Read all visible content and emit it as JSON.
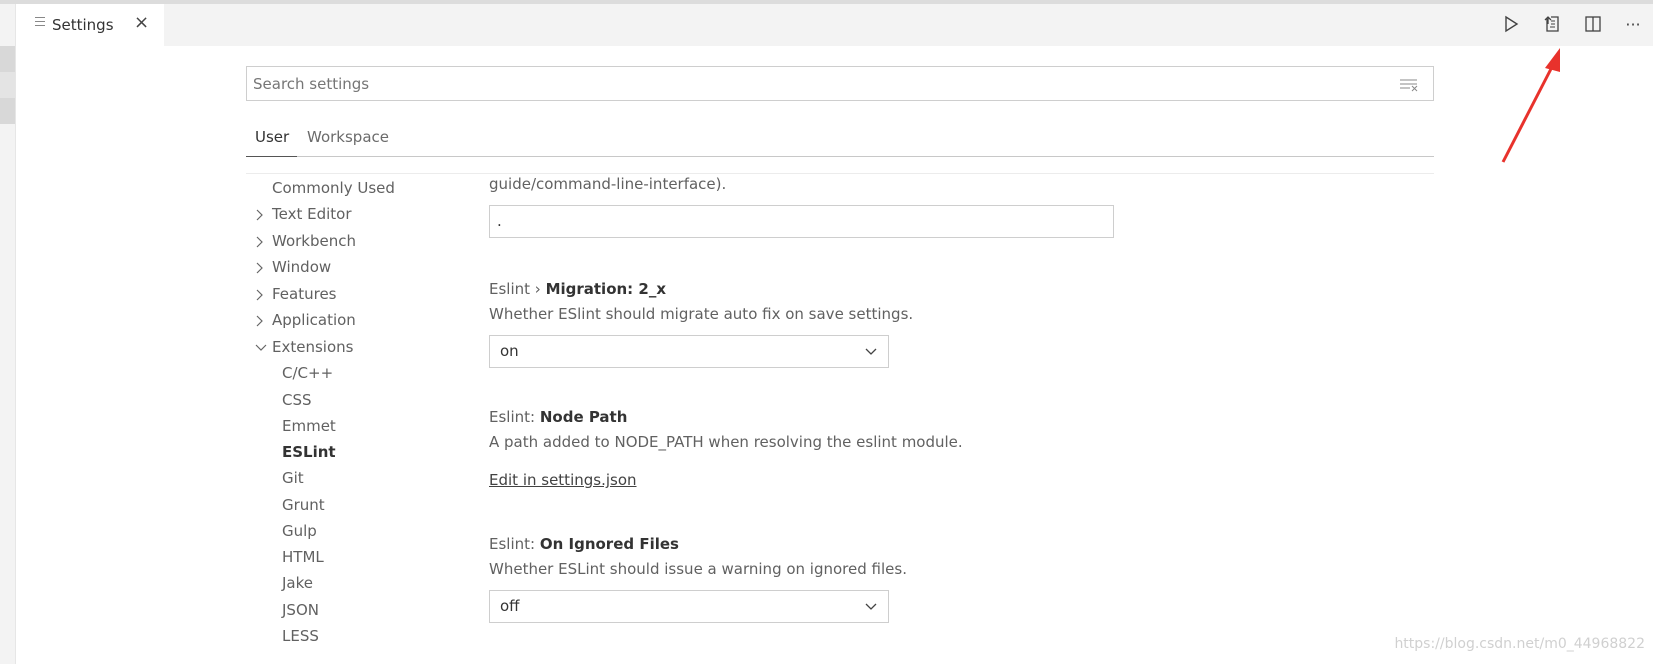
{
  "tab": {
    "title": "Settings",
    "close": "×"
  },
  "toolbar": {
    "actions": [
      {
        "name": "run-icon"
      },
      {
        "name": "open-settings-json-icon"
      },
      {
        "name": "split-editor-icon"
      },
      {
        "name": "more-actions-icon",
        "label": "···"
      }
    ]
  },
  "search": {
    "placeholder": "Search settings",
    "value": ""
  },
  "scope_tabs": {
    "user": "User",
    "workspace": "Workspace"
  },
  "toc": {
    "commonly_used": "Commonly Used",
    "text_editor": "Text Editor",
    "workbench": "Workbench",
    "window": "Window",
    "features": "Features",
    "application": "Application",
    "extensions": "Extensions",
    "ext_items": [
      "C/C++",
      "CSS",
      "Emmet",
      "ESLint",
      "Git",
      "Grunt",
      "Gulp",
      "HTML",
      "Jake",
      "JSON",
      "LESS"
    ],
    "selected": "ESLint"
  },
  "settings": {
    "prev_desc_tail": "guide/command-line-interface).",
    "prev_value": ".",
    "migration": {
      "category": "Eslint › ",
      "name": "Migration: 2_x",
      "desc": "Whether ESlint should migrate auto fix on save settings.",
      "value": "on"
    },
    "node_path": {
      "category": "Eslint: ",
      "name": "Node Path",
      "desc": "A path added to NODE_PATH when resolving the eslint module.",
      "link": "Edit in settings.json"
    },
    "on_ignored": {
      "category": "Eslint: ",
      "name": "On Ignored Files",
      "desc": "Whether ESLint should issue a warning on ignored files.",
      "value": "off"
    }
  },
  "watermark": "https://blog.csdn.net/m0_44968822",
  "colors": {
    "annotation_arrow": "#e8322c"
  }
}
